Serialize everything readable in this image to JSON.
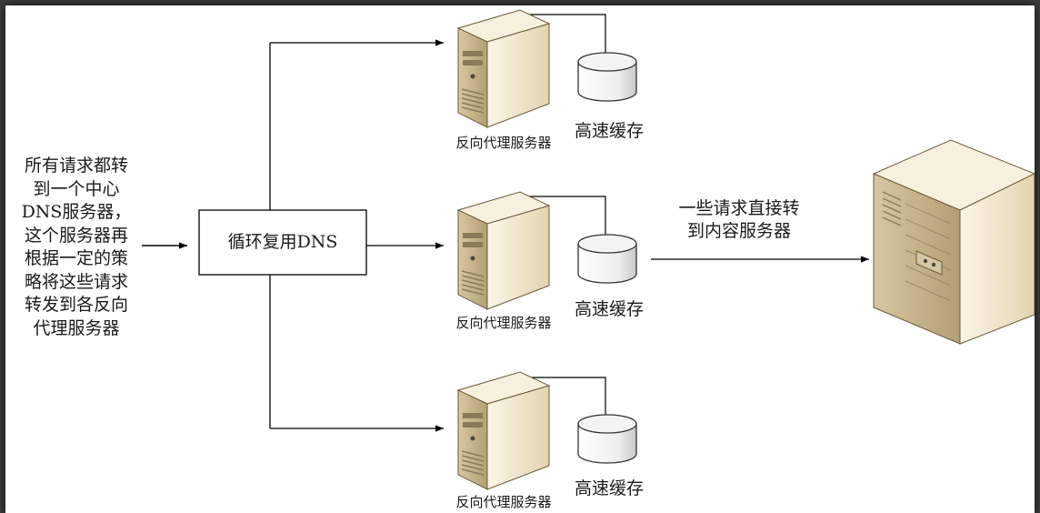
{
  "diagram": {
    "request_note_lines": [
      "所有请求都转",
      "到一个中心",
      "DNS服务器，",
      "这个服务器再",
      "根据一定的策",
      "略将这些请求",
      "转发到各反向",
      "代理服务器"
    ],
    "dns_label": "循环复用DNS",
    "direct_note_lines": [
      "一些请求直接转",
      "到内容服务器"
    ],
    "proxies": [
      {
        "label": "反向代理服务器",
        "cache_label": "高速缓存"
      },
      {
        "label": "反向代理服务器",
        "cache_label": "高速缓存"
      },
      {
        "label": "反向代理服务器",
        "cache_label": "高速缓存"
      }
    ],
    "colors": {
      "background": "#3a3a3a",
      "canvas": "#ffffff",
      "line": "#000000",
      "server_front": "#efe6cf",
      "server_side": "#c8b690",
      "server_top": "#f7f0de"
    },
    "icons": [
      "proxy-server-icon",
      "cache-disk-icon",
      "content-server-icon"
    ]
  }
}
